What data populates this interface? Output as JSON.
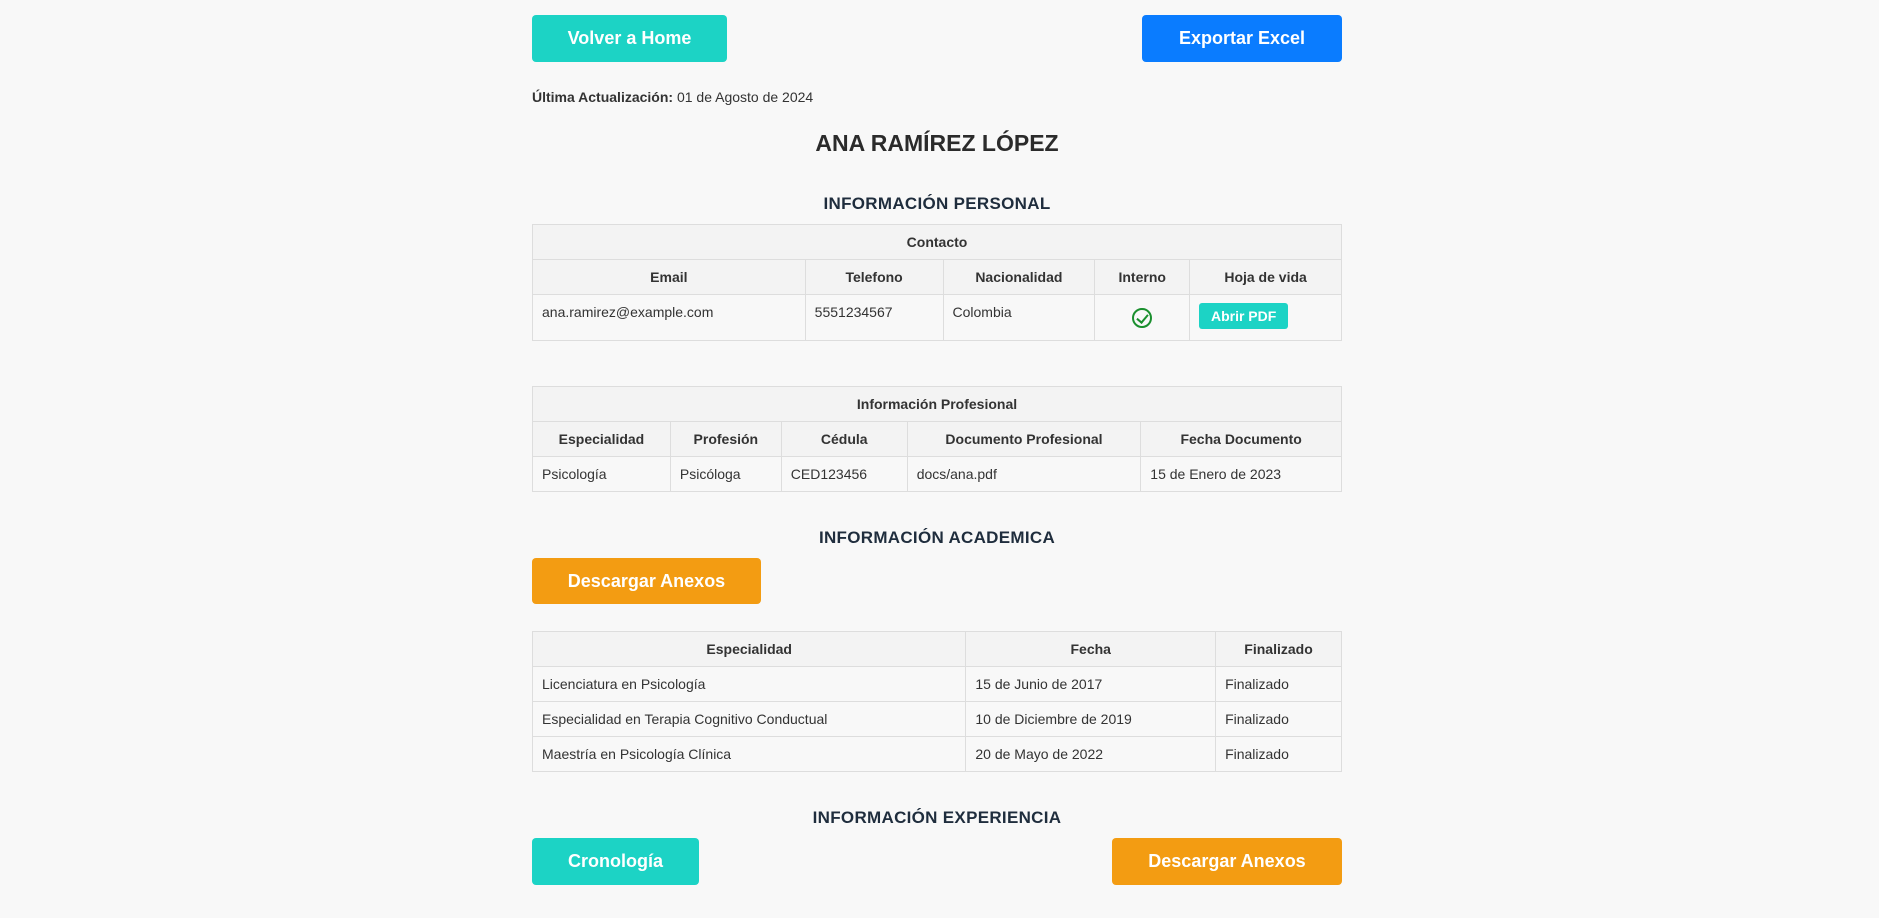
{
  "top": {
    "home_label": "Volver a Home",
    "export_label": "Exportar Excel"
  },
  "updated": {
    "label": "Última Actualización:",
    "value": "01 de Agosto de 2024"
  },
  "person": {
    "name": "ANA RAMÍREZ LÓPEZ"
  },
  "personal": {
    "title": "INFORMACIÓN PERSONAL",
    "group_header": "Contacto",
    "columns": [
      "Email",
      "Telefono",
      "Nacionalidad",
      "Interno",
      "Hoja de vida"
    ],
    "row": {
      "email": "ana.ramirez@example.com",
      "telefono": "5551234567",
      "nacionalidad": "Colombia",
      "interno": true,
      "hoja_label": "Abrir PDF"
    }
  },
  "profesional": {
    "group_header": "Información Profesional",
    "columns": [
      "Especialidad",
      "Profesión",
      "Cédula",
      "Documento Profesional",
      "Fecha Documento"
    ],
    "row": [
      "Psicología",
      "Psicóloga",
      "CED123456",
      "docs/ana.pdf",
      "15 de Enero de 2023"
    ]
  },
  "academica": {
    "title": "INFORMACIÓN ACADEMICA",
    "download_label": "Descargar Anexos",
    "columns": [
      "Especialidad",
      "Fecha",
      "Finalizado"
    ],
    "rows": [
      [
        "Licenciatura en Psicología",
        "15 de Junio de 2017",
        "Finalizado"
      ],
      [
        "Especialidad en Terapia Cognitivo Conductual",
        "10 de Diciembre de 2019",
        "Finalizado"
      ],
      [
        "Maestría en Psicología Clínica",
        "20 de Mayo de 2022",
        "Finalizado"
      ]
    ]
  },
  "experiencia": {
    "title": "INFORMACIÓN EXPERIENCIA",
    "crono_label": "Cronología",
    "download_label": "Descargar Anexos"
  },
  "colors": {
    "teal": "#1cd3c5",
    "blue": "#0a7cff",
    "orange": "#f39c12",
    "check_green": "#1a8f2e"
  },
  "icons": {
    "interno": "check-circle-icon"
  }
}
